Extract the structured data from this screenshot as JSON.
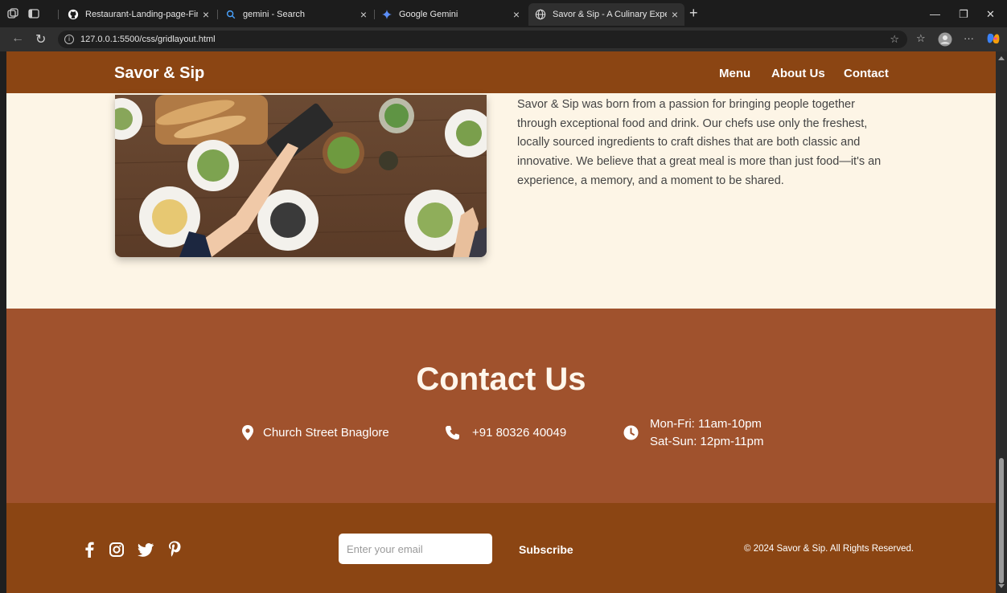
{
  "browser": {
    "tabs": [
      {
        "title": "Restaurant-Landing-page-Final/in",
        "active": false,
        "icon": "github-icon"
      },
      {
        "title": "gemini - Search",
        "active": false,
        "icon": "search-icon"
      },
      {
        "title": "Google Gemini",
        "active": false,
        "icon": "gemini-icon"
      },
      {
        "title": "Savor & Sip - A Culinary Experien",
        "active": true,
        "icon": "globe-icon"
      }
    ],
    "url": "127.0.0.1:5500/css/gridlayout.html"
  },
  "header": {
    "brand": "Savor & Sip",
    "nav": [
      "Menu",
      "About Us",
      "Contact"
    ]
  },
  "about": {
    "text": "Savor & Sip was born from a passion for bringing people together through exceptional food and drink. Our chefs use only the freshest, locally sourced ingredients to craft dishes that are both classic and innovative. We believe that a great meal is more than just food—it's an experience, a memory, and a moment to be shared."
  },
  "contact": {
    "title": "Contact Us",
    "address": "Church Street Bnaglore",
    "phone": "+91 80326 40049",
    "hours_weekday": "Mon-Fri: 11am-10pm",
    "hours_weekend": "Sat-Sun: 12pm-11pm"
  },
  "footer": {
    "social": [
      "facebook-icon",
      "instagram-icon",
      "twitter-icon",
      "pinterest-icon"
    ],
    "email_placeholder": "Enter your email",
    "subscribe_label": "Subscribe",
    "copyright": "© 2024 Savor & Sip. All Rights Reserved."
  },
  "colors": {
    "header": "#8b4513",
    "contact_bg": "#a0522d",
    "page_bg": "#fdf5e6"
  }
}
